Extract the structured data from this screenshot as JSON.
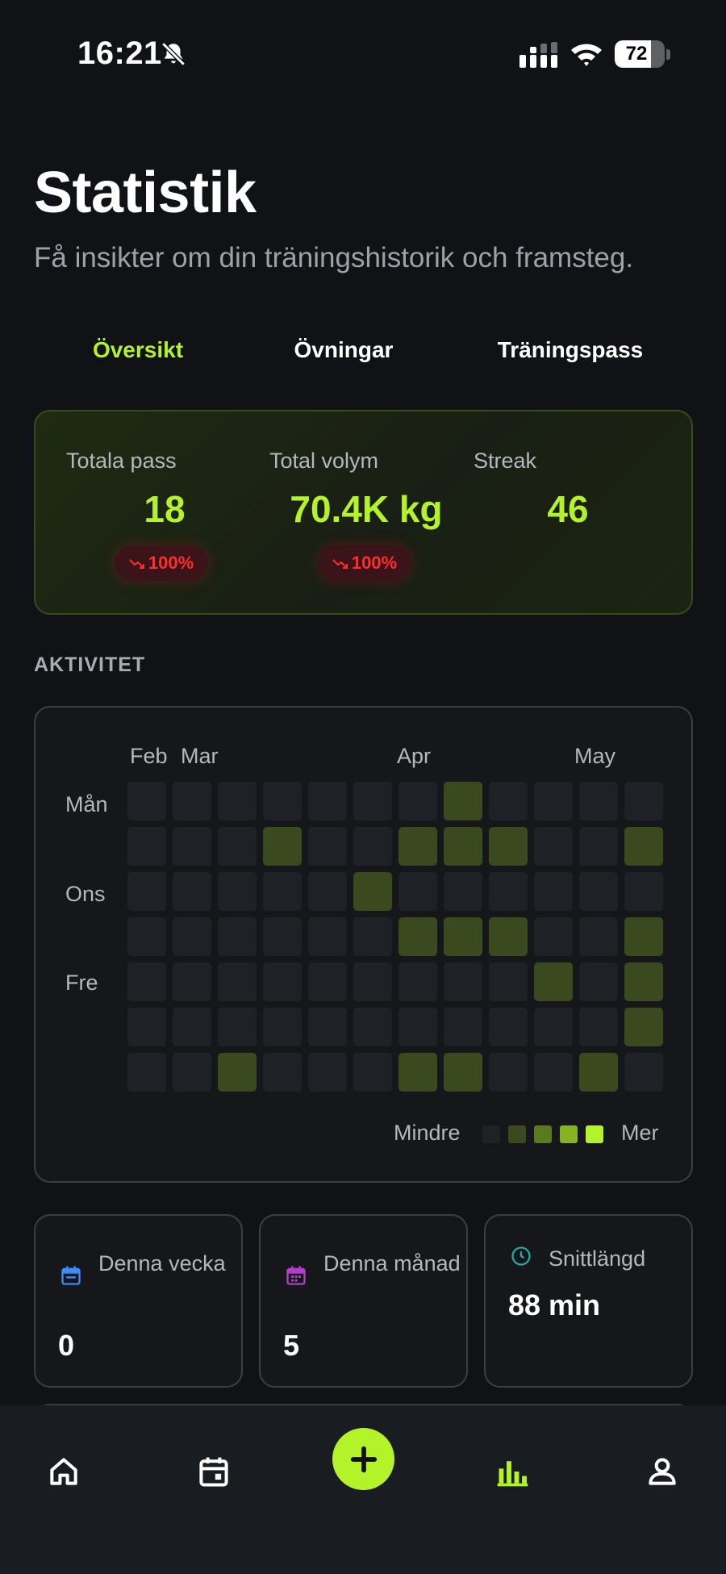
{
  "status_bar": {
    "time": "16:21",
    "battery_level": 72,
    "battery": "72"
  },
  "header": {
    "title": "Statistik",
    "subtitle": "Få insikter om din träningshistorik och framsteg."
  },
  "tabs": [
    {
      "label": "Översikt",
      "active": true
    },
    {
      "label": "Övningar",
      "active": false
    },
    {
      "label": "Träningspass",
      "active": false
    }
  ],
  "overview": {
    "total_sessions": {
      "label": "Totala pass",
      "value": "18",
      "trend": "100%"
    },
    "total_volume": {
      "label": "Total volym",
      "value": "70.4K kg",
      "trend": "100%"
    },
    "streak": {
      "label": "Streak",
      "value": "46"
    }
  },
  "activity": {
    "section_title": "AKTIVITET",
    "months": [
      "Feb",
      "Mar",
      "Apr",
      "May"
    ],
    "day_labels": [
      "Mån",
      "Ons",
      "Fre"
    ],
    "heatmap": {
      "rows": 7,
      "cols": 12,
      "active_cells": [
        [
          0,
          7
        ],
        [
          1,
          3
        ],
        [
          1,
          6
        ],
        [
          1,
          7
        ],
        [
          1,
          8
        ],
        [
          1,
          11
        ],
        [
          2,
          5
        ],
        [
          3,
          6
        ],
        [
          3,
          7
        ],
        [
          3,
          8
        ],
        [
          3,
          11
        ],
        [
          4,
          9
        ],
        [
          4,
          11
        ],
        [
          5,
          11
        ],
        [
          6,
          2
        ],
        [
          6,
          6
        ],
        [
          6,
          7
        ],
        [
          6,
          10
        ]
      ]
    },
    "legend": {
      "less": "Mindre",
      "more": "Mer",
      "colors": [
        "#1e2125",
        "#3b4a1e",
        "#5a7a1e",
        "#86b321",
        "#b4f22a"
      ]
    }
  },
  "summary_cards": [
    {
      "icon": "calendar-week-icon",
      "label": "Denna vecka",
      "value": "0",
      "icon_color": "#3d8bff"
    },
    {
      "icon": "calendar-month-icon",
      "label": "Denna månad",
      "value": "5",
      "icon_color": "#b23fc9"
    },
    {
      "icon": "clock-icon",
      "label": "Snittlängd",
      "value": "88 min",
      "icon_color": "#23a89a"
    }
  ],
  "nav": {
    "items": [
      "home-icon",
      "calendar-icon",
      "add-icon",
      "stats-icon",
      "profile-icon"
    ],
    "active": "stats-icon",
    "accent": "#b4f22a"
  }
}
